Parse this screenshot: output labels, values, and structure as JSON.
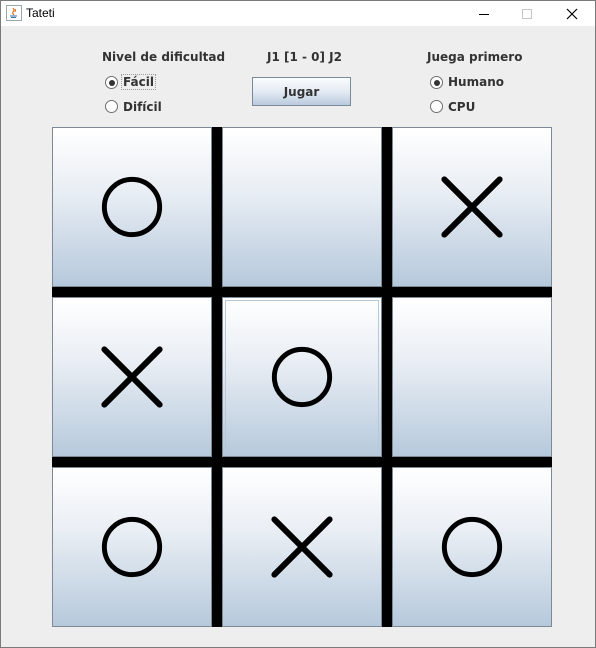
{
  "window": {
    "title": "Tateti"
  },
  "difficulty": {
    "label": "Nivel de dificultad",
    "options": [
      {
        "label": "Fácil",
        "checked": true
      },
      {
        "label": "Difícil",
        "checked": false
      }
    ]
  },
  "score": "J1 [1 - 0] J2",
  "play_button": "Jugar",
  "first_player": {
    "label": "Juega primero",
    "options": [
      {
        "label": "Humano",
        "checked": true
      },
      {
        "label": "CPU",
        "checked": false
      }
    ]
  },
  "board": {
    "cells": [
      "O",
      "",
      "X",
      "X",
      "O",
      "",
      "O",
      "X",
      "O"
    ]
  }
}
